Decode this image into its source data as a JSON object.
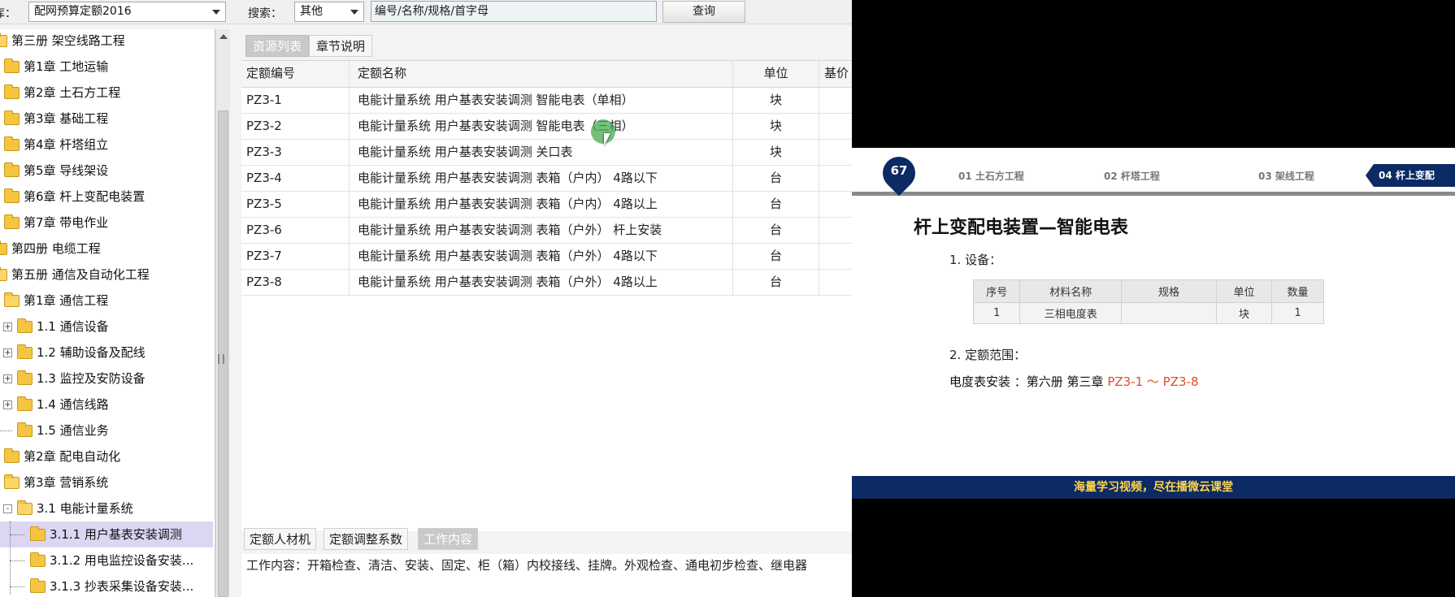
{
  "toolbar": {
    "library_label": "库：",
    "library_value": "配网预算定额2016",
    "search_label": "搜索：",
    "search_type": "其他",
    "search_placeholder": "编号/名称/规格/首字母",
    "query_button": "查询"
  },
  "tree": [
    {
      "label": "第三册 架空线路工程"
    },
    {
      "label": "第1章 工地运输"
    },
    {
      "label": "第2章 土石方工程"
    },
    {
      "label": "第3章 基础工程"
    },
    {
      "label": "第4章 杆塔组立"
    },
    {
      "label": "第5章 导线架设"
    },
    {
      "label": "第6章 杆上变配电装置"
    },
    {
      "label": "第7章 带电作业"
    },
    {
      "label": "第四册 电缆工程"
    },
    {
      "label": "第五册 通信及自动化工程"
    },
    {
      "label": "第1章 通信工程"
    },
    {
      "label": "1.1 通信设备"
    },
    {
      "label": "1.2 辅助设备及配线"
    },
    {
      "label": "1.3 监控及安防设备"
    },
    {
      "label": "1.4 通信线路"
    },
    {
      "label": "1.5 通信业务"
    },
    {
      "label": "第2章 配电自动化"
    },
    {
      "label": "第3章 营销系统"
    },
    {
      "label": "3.1 电能计量系统"
    },
    {
      "label": "3.1.1 用户基表安装调测"
    },
    {
      "label": "3.1.2 用电监控设备安装..."
    },
    {
      "label": "3.1.3 抄表采集设备安装..."
    }
  ],
  "tabs": {
    "resource_list": "资源列表",
    "chapter_notes": "章节说明"
  },
  "grid": {
    "headers": [
      "定额编号",
      "定额名称",
      "单位",
      "基价"
    ],
    "rows": [
      {
        "code": "PZ3-1",
        "name": "电能计量系统 用户基表安装调测 智能电表（单相）",
        "unit": "块"
      },
      {
        "code": "PZ3-2",
        "name": "电能计量系统 用户基表安装调测 智能电表（三相）",
        "unit": "块"
      },
      {
        "code": "PZ3-3",
        "name": "电能计量系统 用户基表安装调测 关口表",
        "unit": "块"
      },
      {
        "code": "PZ3-4",
        "name": "电能计量系统 用户基表安装调测 表箱（户内） 4路以下",
        "unit": "台"
      },
      {
        "code": "PZ3-5",
        "name": "电能计量系统 用户基表安装调测 表箱（户内） 4路以上",
        "unit": "台"
      },
      {
        "code": "PZ3-6",
        "name": "电能计量系统 用户基表安装调测 表箱（户外） 杆上安装",
        "unit": "台"
      },
      {
        "code": "PZ3-7",
        "name": "电能计量系统 用户基表安装调测 表箱（户外） 4路以下",
        "unit": "台"
      },
      {
        "code": "PZ3-8",
        "name": "电能计量系统 用户基表安装调测 表箱（户外） 4路以上",
        "unit": "台"
      }
    ]
  },
  "bottom_tabs": [
    "定额人材机",
    "定额调整系数",
    "工作内容"
  ],
  "work_content": "工作内容：开箱检查、清洁、安装、固定、柜（箱）内校接线、挂牌。外观检查、通电初步检查、继电器",
  "slide": {
    "page_number": "67",
    "steps": [
      "01 土石方工程",
      "02 杆塔工程",
      "03 架线工程",
      "04 杆上变配"
    ],
    "title": "杆上变配电装置—智能电表",
    "equipment_heading": "1. 设备：",
    "table_headers": [
      "序号",
      "材料名称",
      "规格",
      "单位",
      "数量"
    ],
    "table_row": [
      "1",
      "三相电度表",
      "",
      "块",
      "1"
    ],
    "scope_heading": "2. 定额范围：",
    "scope_prefix": "电度表安装 ：第六册 第三章 ",
    "scope_range": "PZ3-1 ～ PZ3-8",
    "footer": "海量学习视频，尽在播微云课堂"
  }
}
